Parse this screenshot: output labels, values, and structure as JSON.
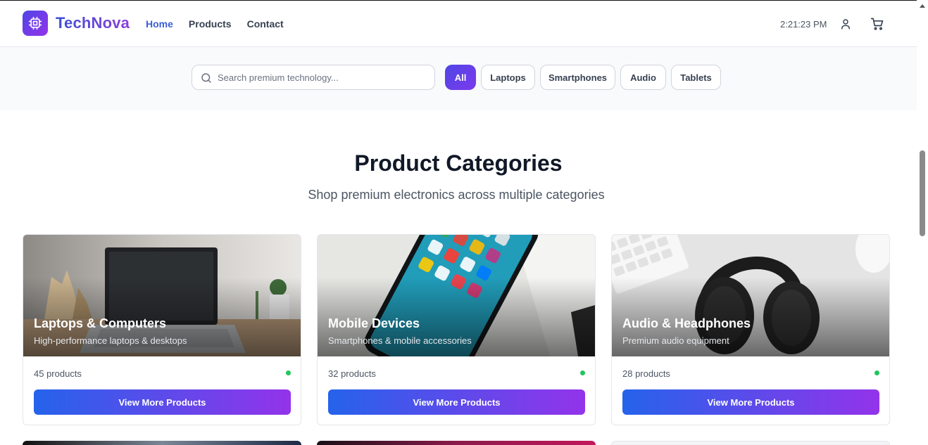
{
  "header": {
    "brand": "TechNova",
    "nav": [
      "Home",
      "Products",
      "Contact"
    ],
    "active_nav": "Home",
    "time": "2:21:23 PM",
    "icons": [
      "chip-icon",
      "user-icon",
      "cart-icon"
    ]
  },
  "search": {
    "placeholder": "Search premium technology...",
    "value": ""
  },
  "filters": [
    "All",
    "Laptops",
    "Smartphones",
    "Audio",
    "Tablets"
  ],
  "active_filter": "All",
  "section": {
    "title": "Product Categories",
    "subtitle": "Shop premium electronics across multiple categories"
  },
  "categories": [
    {
      "name": "Laptops & Computers",
      "description": "High-performance laptops & desktops",
      "count": "45 products",
      "button": "View More Products",
      "status": "active"
    },
    {
      "name": "Mobile Devices",
      "description": "Smartphones & mobile accessories",
      "count": "32 products",
      "button": "View More Products",
      "status": "active"
    },
    {
      "name": "Audio & Headphones",
      "description": "Premium audio equipment",
      "count": "28 products",
      "button": "View More Products",
      "status": "active"
    }
  ],
  "colors": {
    "accent_start": "#2563eb",
    "accent_end": "#9333ea",
    "status_dot": "#22c55e",
    "active_nav": "#3b5fd6"
  }
}
